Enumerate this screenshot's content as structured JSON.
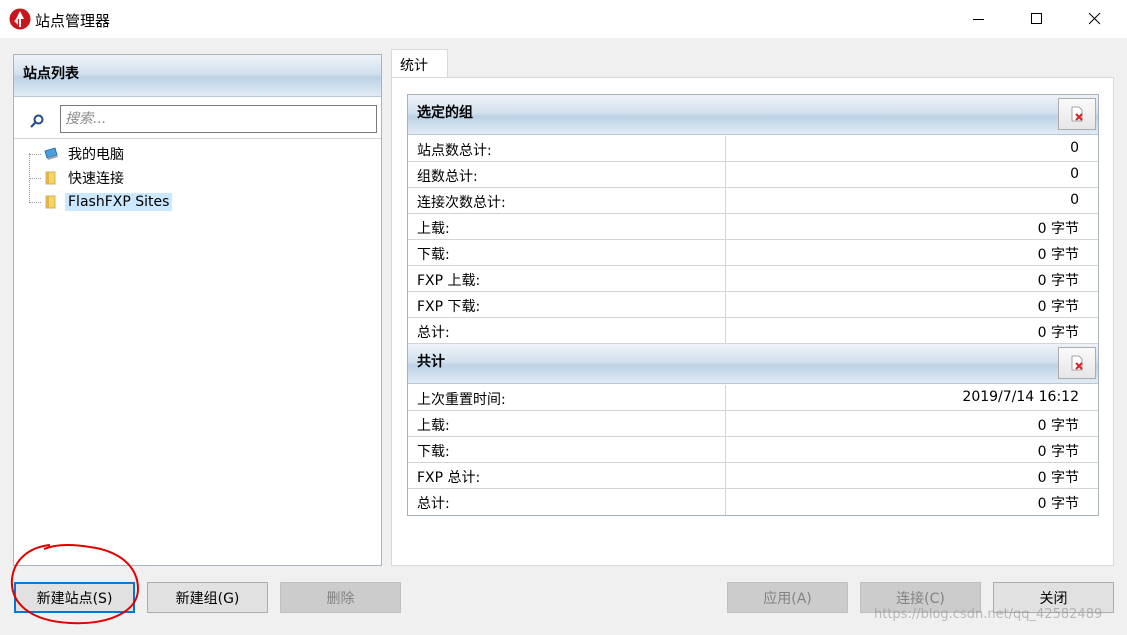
{
  "window": {
    "title": "站点管理器"
  },
  "site_list": {
    "header": "站点列表",
    "search_placeholder": "搜索...",
    "tree": [
      {
        "label": "我的电脑",
        "icon": "computer-icon"
      },
      {
        "label": "快速连接",
        "icon": "folder-icon"
      },
      {
        "label": "FlashFXP Sites",
        "icon": "folder-icon",
        "selected": true
      }
    ]
  },
  "tabs": [
    {
      "label": "统计",
      "active": true
    }
  ],
  "stats": {
    "selected_group": {
      "header": "选定的组",
      "rows": [
        {
          "key": "站点数总计:",
          "value": "0"
        },
        {
          "key": "组数总计:",
          "value": "0"
        },
        {
          "key": "连接次数总计:",
          "value": "0"
        },
        {
          "key": "上载:",
          "value": "0 字节"
        },
        {
          "key": "下载:",
          "value": "0 字节"
        },
        {
          "key": "FXP 上载:",
          "value": "0 字节"
        },
        {
          "key": "FXP 下载:",
          "value": "0 字节"
        },
        {
          "key": "总计:",
          "value": "0 字节"
        }
      ]
    },
    "total": {
      "header": "共计",
      "rows": [
        {
          "key": "上次重置时间:",
          "value": "2019/7/14 16:12"
        },
        {
          "key": "上载:",
          "value": "0 字节"
        },
        {
          "key": "下载:",
          "value": "0 字节"
        },
        {
          "key": "FXP 总计:",
          "value": "0 字节"
        },
        {
          "key": "总计:",
          "value": "0 字节"
        }
      ]
    }
  },
  "buttons": {
    "new_site": "新建站点(S)",
    "new_group": "新建组(G)",
    "delete": "删除",
    "apply": "应用(A)",
    "connect": "连接(C)",
    "close": "关闭"
  },
  "watermark": "https://blog.csdn.net/qq_42582489",
  "colors": {
    "accent": "#0078d7",
    "annotation_red": "#e00000",
    "selection": "#cce8ff"
  }
}
